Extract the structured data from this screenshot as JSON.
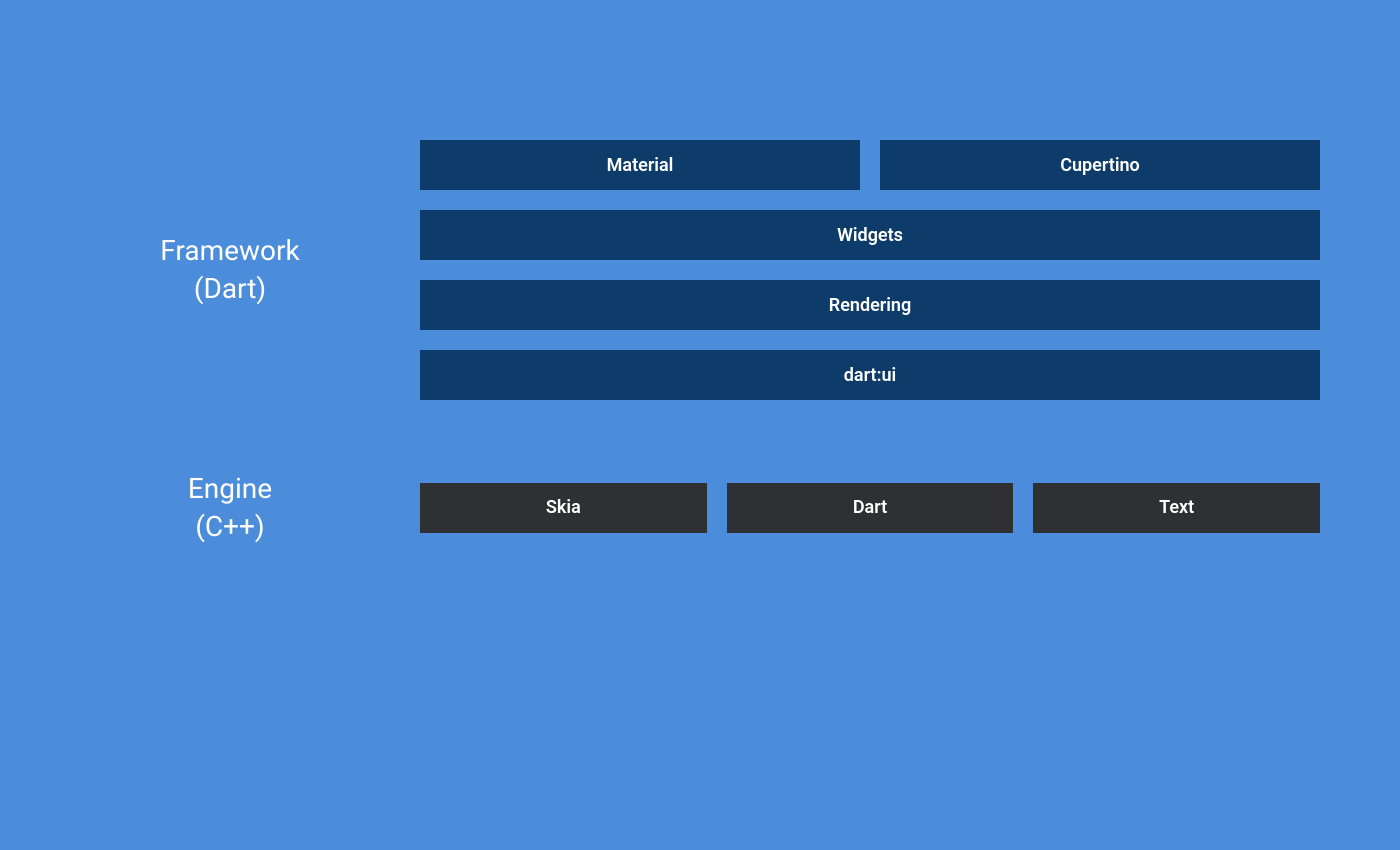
{
  "framework": {
    "label_line1": "Framework",
    "label_line2": "(Dart)",
    "rows": [
      {
        "boxes": [
          "Material",
          "Cupertino"
        ]
      },
      {
        "boxes": [
          "Widgets"
        ]
      },
      {
        "boxes": [
          "Rendering"
        ]
      },
      {
        "boxes": [
          "dart:ui"
        ]
      }
    ]
  },
  "engine": {
    "label_line1": "Engine",
    "label_line2": "(C++)",
    "rows": [
      {
        "boxes": [
          "Skia",
          "Dart",
          "Text"
        ]
      }
    ]
  },
  "colors": {
    "background": "#4b8cdb",
    "framework_box": "#0e3c6a",
    "engine_box": "#2e3033",
    "text": "#ffffff"
  }
}
